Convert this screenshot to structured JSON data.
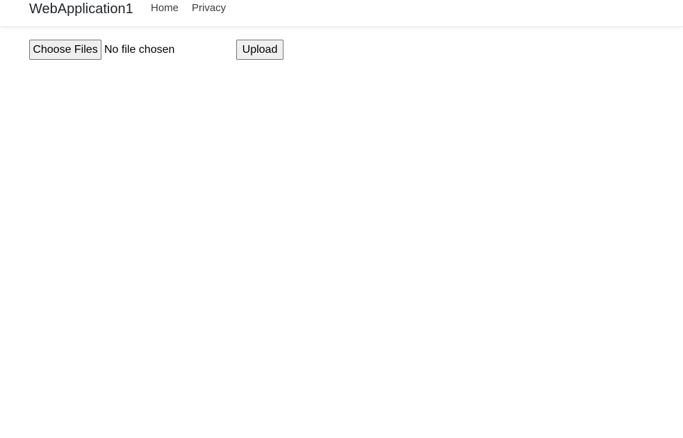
{
  "navbar": {
    "brand": "WebApplication1",
    "links": [
      {
        "label": "Home"
      },
      {
        "label": "Privacy"
      }
    ]
  },
  "upload_form": {
    "file_input": {
      "button_label": "Choose Files",
      "status_text": "No file chosen"
    },
    "submit_label": "Upload"
  },
  "colors": {
    "navbar_border": "#e5e5e5",
    "button_background": "#efefef",
    "button_border": "#767676",
    "text": "#212529"
  }
}
